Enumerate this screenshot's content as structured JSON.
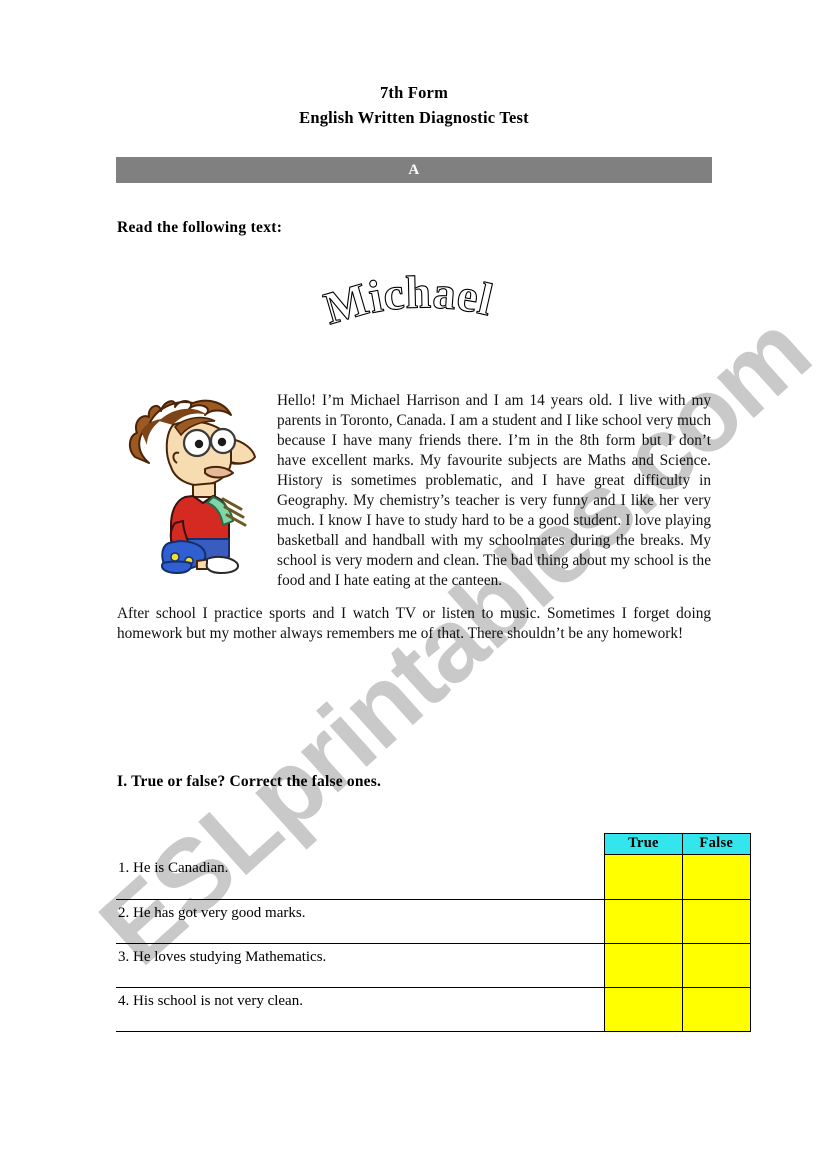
{
  "document": {
    "title_line_1": "7th Form",
    "title_line_2": "English Written Diagnostic Test",
    "version_label": "A",
    "read_instruction": "Read the following text:",
    "name_art": "Michael"
  },
  "reading": {
    "paragraph_1": "Hello! I’m Michael Harrison and I am 14 years old. I live with my parents in Toronto, Canada. I am a student and I like school very much because I have many friends there. I’m in the 8th form but I don’t have excellent marks. My favourite subjects are Maths and Science. History is sometimes problematic, and I have great difficulty in Geography. My chemistry’s teacher is very funny and I like her very much. I know I have to study hard to be a good student. I love playing basketball and handball with my schoolmates during the breaks. My school is very modern and clean. The bad thing about my school is the food and I hate eating at the canteen.",
    "paragraph_2": "After school I practice sports and I watch TV or listen to music. Sometimes I forget doing homework but my mother always remembers me of that. There shouldn’t be any homework!"
  },
  "exercise_1": {
    "heading": "I. True or false? Correct the false ones.",
    "columns": {
      "statement": "",
      "true": "True",
      "false": "False"
    },
    "rows": [
      {
        "statement": "1. He is Canadian.",
        "true": "",
        "false": ""
      },
      {
        "statement": "2. He has got very good marks.",
        "true": "",
        "false": ""
      },
      {
        "statement": "3. He loves studying Mathematics.",
        "true": "",
        "false": ""
      },
      {
        "statement": "4. His school is not very clean.",
        "true": "",
        "false": ""
      }
    ]
  },
  "watermark": {
    "text": "ESLprintables.com"
  },
  "colors": {
    "section_bar": "#808080",
    "table_header": "#33e6ee",
    "table_cell": "#ffff00",
    "watermark": "#c9c9c9"
  },
  "clipart": {
    "name": "cartoon-schoolboy-with-glasses-and-backpack",
    "hair": "#9c5a22",
    "shirt": "#d42a22",
    "shorts": "#3a5bbf",
    "backpack": "#2f5fd0",
    "strap": "#7fd6a6",
    "skin": "#f6dcb0"
  }
}
